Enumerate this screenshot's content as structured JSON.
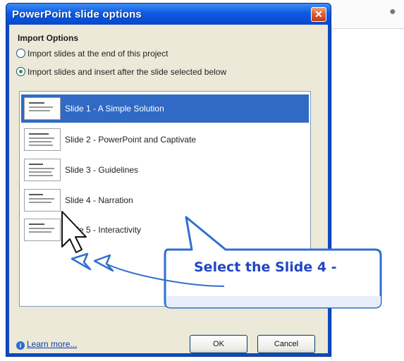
{
  "dialog": {
    "title": "PowerPoint slide options",
    "close_label": "✕",
    "section_title": "Import Options",
    "radio_options": [
      {
        "label": "Import slides at the end of this project",
        "checked": false
      },
      {
        "label": "Import slides and insert after the slide selected below",
        "checked": true
      }
    ],
    "slides": [
      {
        "label": "Slide 1 - A Simple Solution",
        "selected": true
      },
      {
        "label": "Slide 2 - PowerPoint and Captivate",
        "selected": false
      },
      {
        "label": "Slide 3 - Guidelines",
        "selected": false
      },
      {
        "label": "Slide 4 - Narration",
        "selected": false
      },
      {
        "label": "Slide 5 - Interactivity",
        "selected": false
      }
    ],
    "learn_more": "Learn more...",
    "ok_label": "OK",
    "cancel_label": "Cancel"
  },
  "callout": {
    "text": "Select the Slide 4 -",
    "color": "#2146c4"
  },
  "colors": {
    "titlebar": "#0d5be4",
    "selection": "#316ac5",
    "dialog_bg": "#ece9d8"
  }
}
